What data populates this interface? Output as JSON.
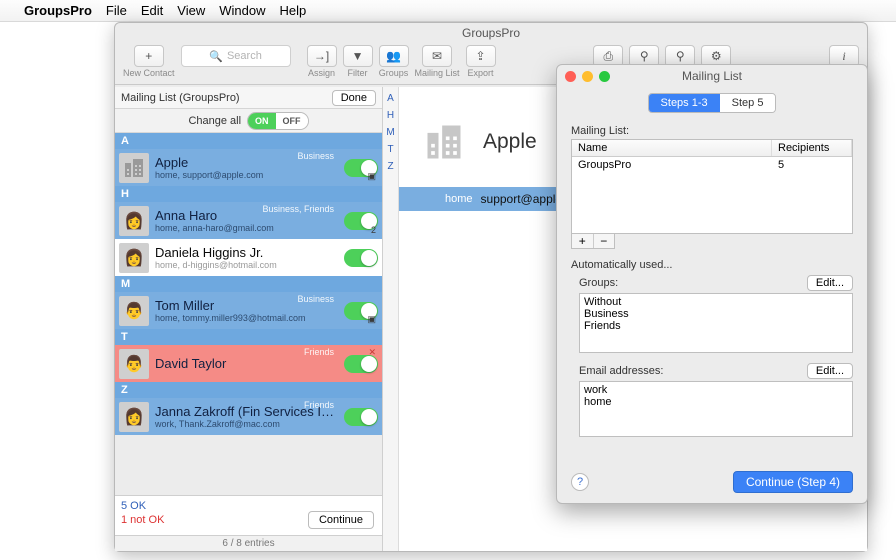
{
  "menubar": {
    "app": "GroupsPro",
    "items": [
      "File",
      "Edit",
      "View",
      "Window",
      "Help"
    ]
  },
  "window_title": "GroupsPro",
  "toolbar": {
    "new_contact": {
      "icon": "+",
      "label": "New Contact"
    },
    "search_placeholder": "Search",
    "assign": {
      "icon": "→]",
      "label": "Assign"
    },
    "filter": {
      "icon": "▾",
      "label": "Filter"
    },
    "groups": {
      "icon": "∷",
      "label": "Groups"
    },
    "mailing": {
      "icon": "✉",
      "label": "Mailing List"
    },
    "export": {
      "icon": "⇪",
      "label": "Export"
    },
    "print_icon": "⎙",
    "zoom_in_icon": "⚲+",
    "zoom_out_icon": "⚲-",
    "gear_icon": "⚙",
    "info_icon": "i"
  },
  "mailing_header": "Mailing List (GroupsPro)",
  "done_label": "Done",
  "change_all_label": "Change all",
  "seg_on": "ON",
  "seg_off": "OFF",
  "index_letters": [
    "A",
    "H",
    "M",
    "T",
    "Z"
  ],
  "contacts": [
    {
      "section": "A",
      "name": "Apple",
      "sub": "home, support@apple.com",
      "tags": "Business",
      "avatar": "building",
      "row": "blue"
    },
    {
      "section": "H",
      "name": "Anna Haro",
      "sub": "home, anna-haro@gmail.com",
      "tags": "Business, Friends",
      "avatar": "person",
      "row": "blue",
      "badge": "2"
    },
    {
      "section": "",
      "name": "Daniela Higgins Jr.",
      "sub": "home, d-higgins@hotmail.com",
      "tags": "",
      "avatar": "person",
      "row": "white"
    },
    {
      "section": "M",
      "name": "Tom Miller",
      "sub": "home, tommy.miller993@hotmail.com",
      "tags": "Business",
      "avatar": "person",
      "row": "blue"
    },
    {
      "section": "T",
      "name": "David Taylor",
      "sub": "",
      "tags": "Friends",
      "avatar": "person",
      "row": "red",
      "x": true
    },
    {
      "section": "Z",
      "name": "Janna Zakroff (Fin Services Inc.)",
      "sub": "work, Thank.Zakroff@mac.com",
      "tags": "Friends",
      "avatar": "person",
      "row": "blue"
    }
  ],
  "footer": {
    "ok": "5 OK",
    "nok": "1 not OK",
    "continue": "Continue",
    "entries": "6 / 8 entries"
  },
  "card": {
    "title": "Apple",
    "pill_label": "home",
    "pill_val": "support@apple.com"
  },
  "dlg": {
    "title": "Mailing List",
    "step_a": "Steps 1-3",
    "step_b": "Step 5",
    "ml_label": "Mailing List:",
    "th_name": "Name",
    "th_rec": "Recipients",
    "row_name": "GroupsPro",
    "row_rec": "5",
    "auto": "Automatically used...",
    "groups_label": "Groups:",
    "edit": "Edit...",
    "groups_items": [
      "Without",
      "Business",
      "Friends"
    ],
    "emails_label": "Email addresses:",
    "emails_items": [
      "work",
      "home"
    ],
    "help": "?",
    "continue": "Continue (Step 4)"
  }
}
